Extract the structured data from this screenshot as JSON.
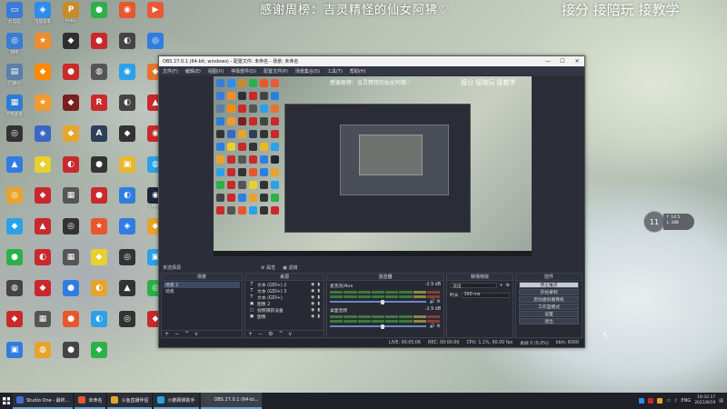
{
  "overlay": {
    "thanks_text": "感谢周榜：吉灵精怪的仙女阿狒♡",
    "offer_text": "接分 接陪玩 接教学"
  },
  "desktop_icons": [
    {
      "label": "此电脑",
      "color": "#3a7bd5",
      "glyph": "▭"
    },
    {
      "label": "电脑管家",
      "color": "#2d8cf0",
      "glyph": "◈"
    },
    {
      "label": "PUBG",
      "color": "#c98b2a",
      "glyph": "P"
    },
    {
      "label": "",
      "color": "#2bb14a",
      "glyph": "●"
    },
    {
      "label": "",
      "color": "#e8572c",
      "glyph": "◉"
    },
    {
      "label": "",
      "color": "#e85a3a",
      "glyph": "▶"
    },
    {
      "label": "网络",
      "color": "#3a7bd5",
      "glyph": "◎"
    },
    {
      "label": "",
      "color": "#f08c2e",
      "glyph": "★"
    },
    {
      "label": "",
      "color": "#2f2f2f",
      "glyph": "◆"
    },
    {
      "label": "",
      "color": "#c9282d",
      "glyph": "●"
    },
    {
      "label": "",
      "color": "#444",
      "glyph": "◐"
    },
    {
      "label": "",
      "color": "#2f7de1",
      "glyph": "◎"
    },
    {
      "label": "回收站",
      "color": "#5b7fa6",
      "glyph": "▤"
    },
    {
      "label": "",
      "color": "#ff8a00",
      "glyph": "◆"
    },
    {
      "label": "",
      "color": "#c92b2b",
      "glyph": "●"
    },
    {
      "label": "",
      "color": "#555",
      "glyph": "◍"
    },
    {
      "label": "",
      "color": "#2aa1e8",
      "glyph": "◉"
    },
    {
      "label": "",
      "color": "#e6742e",
      "glyph": "◆"
    },
    {
      "label": "控制面板",
      "color": "#2e7bd6",
      "glyph": "▦"
    },
    {
      "label": "",
      "color": "#f29a2e",
      "glyph": "★"
    },
    {
      "label": "",
      "color": "#7a1f1f",
      "glyph": "◆"
    },
    {
      "label": "",
      "color": "#c92b2b",
      "glyph": "R"
    },
    {
      "label": "",
      "color": "#444",
      "glyph": "◐"
    },
    {
      "label": "",
      "color": "#c9282d",
      "glyph": "▲"
    },
    {
      "label": "",
      "color": "#333",
      "glyph": "◎"
    },
    {
      "label": "",
      "color": "#3a66c4",
      "glyph": "◈"
    },
    {
      "label": "",
      "color": "#e6a52e",
      "glyph": "◆"
    },
    {
      "label": "",
      "color": "#2f3e5a",
      "glyph": "A"
    },
    {
      "label": "",
      "color": "#333",
      "glyph": "◆"
    },
    {
      "label": "",
      "color": "#c9282d",
      "glyph": "◉"
    },
    {
      "label": "",
      "color": "#2f7de1",
      "glyph": "▲"
    },
    {
      "label": "",
      "color": "#e8d02e",
      "glyph": "◆"
    },
    {
      "label": "",
      "color": "#c9282d",
      "glyph": "◐"
    },
    {
      "label": "",
      "color": "#333",
      "glyph": "●"
    },
    {
      "label": "",
      "color": "#e8b92e",
      "glyph": "▣"
    },
    {
      "label": "",
      "color": "#2aa1e8",
      "glyph": "◍"
    },
    {
      "label": "",
      "color": "#e8a22e",
      "glyph": "◎"
    },
    {
      "label": "",
      "color": "#c9282d",
      "glyph": "◆"
    },
    {
      "label": "",
      "color": "#555",
      "glyph": "▦"
    },
    {
      "label": "",
      "color": "#c92b2b",
      "glyph": "●"
    },
    {
      "label": "",
      "color": "#2f7de1",
      "glyph": "◐"
    },
    {
      "label": "Steam",
      "color": "#1b2838",
      "glyph": "◉"
    },
    {
      "label": "",
      "color": "#2aa1e8",
      "glyph": "◆"
    },
    {
      "label": "",
      "color": "#c9282d",
      "glyph": "▲"
    },
    {
      "label": "",
      "color": "#333",
      "glyph": "◎"
    },
    {
      "label": "",
      "color": "#e8572c",
      "glyph": "★"
    },
    {
      "label": "",
      "color": "#2f7de1",
      "glyph": "◈"
    },
    {
      "label": "",
      "color": "#e8a22e",
      "glyph": "◆"
    },
    {
      "label": "",
      "color": "#2bb14a",
      "glyph": "●"
    },
    {
      "label": "",
      "color": "#c9282d",
      "glyph": "◐"
    },
    {
      "label": "",
      "color": "#555",
      "glyph": "▦"
    },
    {
      "label": "",
      "color": "#e8d02e",
      "glyph": "◆"
    },
    {
      "label": "",
      "color": "#333",
      "glyph": "◎"
    },
    {
      "label": "",
      "color": "#2aa1e8",
      "glyph": "▣"
    },
    {
      "label": "",
      "color": "#444",
      "glyph": "◍"
    },
    {
      "label": "",
      "color": "#c9282d",
      "glyph": "◆"
    },
    {
      "label": "",
      "color": "#2f7de1",
      "glyph": "●"
    },
    {
      "label": "",
      "color": "#e8a22e",
      "glyph": "◐"
    },
    {
      "label": "",
      "color": "#333",
      "glyph": "▲"
    },
    {
      "label": "",
      "color": "#2bb14a",
      "glyph": "◎"
    },
    {
      "label": "",
      "color": "#c92b2b",
      "glyph": "◆"
    },
    {
      "label": "",
      "color": "#555",
      "glyph": "▦"
    },
    {
      "label": "",
      "color": "#e8572c",
      "glyph": "●"
    },
    {
      "label": "",
      "color": "#2aa1e8",
      "glyph": "◐"
    },
    {
      "label": "",
      "color": "#333",
      "glyph": "◎"
    },
    {
      "label": "",
      "color": "#c9282d",
      "glyph": "◆"
    },
    {
      "label": "",
      "color": "#2f7de1",
      "glyph": "▣"
    },
    {
      "label": "",
      "color": "#e8a22e",
      "glyph": "◍"
    },
    {
      "label": "",
      "color": "#444",
      "glyph": "●"
    },
    {
      "label": "",
      "color": "#2bb14a",
      "glyph": "◆"
    }
  ],
  "obs": {
    "title": "OBS 27.0.1 (64-bit, windows) - 配置文件: 未命名 - 场景: 未命名",
    "window_controls": {
      "minimize": "—",
      "maximize": "☐",
      "close": "✕"
    },
    "menu": [
      "文件(F)",
      "编辑(E)",
      "视图(V)",
      "停靠部件(D)",
      "配置文件(P)",
      "场景集合(S)",
      "工具(T)",
      "帮助(H)"
    ],
    "preview": {
      "overlay_thanks": "感谢周榜：吉灵精怪的仙女阿狒♡",
      "overlay_offer": "接分 接陪玩 接教学"
    },
    "tools_bar": {
      "left": "未选择源",
      "props": "⚙ 属性",
      "filters": "▣ 滤镜"
    },
    "scenes": {
      "header": "场景",
      "items": [
        "场景 2",
        "场景"
      ],
      "selected": 0,
      "footer": [
        "+",
        "−",
        "^",
        "v"
      ]
    },
    "sources": {
      "header": "来源",
      "items": [
        {
          "type": "T",
          "name": "文本 (GDI+) 2"
        },
        {
          "type": "T",
          "name": "文本 (GDI+) 3"
        },
        {
          "type": "T",
          "name": "文本 (GDI+)"
        },
        {
          "type": "▣",
          "name": "图像 2"
        },
        {
          "type": "▢",
          "name": "视频捕获设备"
        },
        {
          "type": "▣",
          "name": "图像"
        }
      ],
      "footer": [
        "+",
        "−",
        "⚙",
        "^",
        "v"
      ]
    },
    "mixer": {
      "header": "混音器",
      "channels": [
        {
          "name": "麦克风/Aux",
          "db": "-2.9 dB"
        },
        {
          "name": "桌面音频",
          "db": "-2.9 dB"
        }
      ],
      "volume_fraction": 0.66
    },
    "transitions": {
      "header": "转场特效",
      "type": "淡出",
      "duration_label": "时长",
      "duration_value": "300 ms"
    },
    "controls": {
      "header": "控件",
      "buttons": [
        "停止推流",
        "开始录制",
        "启动虚拟摄像机",
        "工作室模式",
        "设置",
        "退出"
      ]
    },
    "status": {
      "live": "LIVE: 00:05:06",
      "rec": "REC: 00:00:00",
      "cpu": "CPU: 1.1%, 60.00 fps",
      "dropped": "丢帧 0 (0.0%)",
      "kbps": "kb/s: 6000"
    }
  },
  "widget": {
    "value": "11",
    "line1": "↑ 14.5",
    "line2": "↓ 348"
  },
  "taskbar": {
    "items": [
      {
        "label": "Studio One - 最终...",
        "color": "#3d6ed0"
      },
      {
        "label": "未命名",
        "color": "#e8572c"
      },
      {
        "label": "斗鱼直播伴侣",
        "color": "#e8a22e"
      },
      {
        "label": "小鹅网课助手",
        "color": "#2aa1e8"
      },
      {
        "label": "OBS 27.0.1 (64-bi...",
        "color": "#444"
      }
    ],
    "tray": {
      "lang": "ENG",
      "time": "19:32:17",
      "date": "2021/8/19"
    }
  }
}
